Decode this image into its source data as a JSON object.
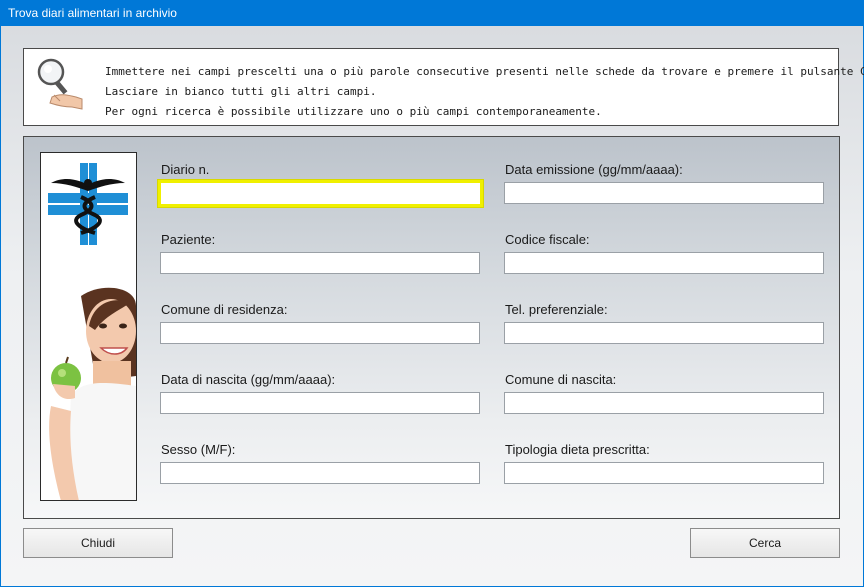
{
  "window": {
    "title": "Trova diari alimentari in archivio"
  },
  "info": {
    "line1": "Immettere nei campi prescelti una o più parole consecutive presenti nelle schede da trovare e premere il pulsante Cerca.",
    "line2": "Lasciare in bianco tutti gli altri campi.",
    "line3": "Per ogni ricerca è possibile utilizzare uno o più campi contemporaneamente."
  },
  "fields": {
    "diario": {
      "label": "Diario n.",
      "value": ""
    },
    "data_emissione": {
      "label": "Data emissione (gg/mm/aaaa):",
      "value": ""
    },
    "paziente": {
      "label": "Paziente:",
      "value": ""
    },
    "codice_fiscale": {
      "label": "Codice fiscale:",
      "value": ""
    },
    "comune_residenza": {
      "label": "Comune di residenza:",
      "value": ""
    },
    "tel_preferenziale": {
      "label": "Tel. preferenziale:",
      "value": ""
    },
    "data_nascita": {
      "label": "Data di nascita (gg/mm/aaaa):",
      "value": ""
    },
    "comune_nascita": {
      "label": "Comune di nascita:",
      "value": ""
    },
    "sesso": {
      "label": "Sesso (M/F):",
      "value": ""
    },
    "tipologia_dieta": {
      "label": "Tipologia dieta prescritta:",
      "value": ""
    }
  },
  "buttons": {
    "close": "Chiudi",
    "search": "Cerca"
  },
  "colors": {
    "titlebar": "#0078d7",
    "focus": "#f0f000",
    "caduceus": "#1f8fd6"
  }
}
